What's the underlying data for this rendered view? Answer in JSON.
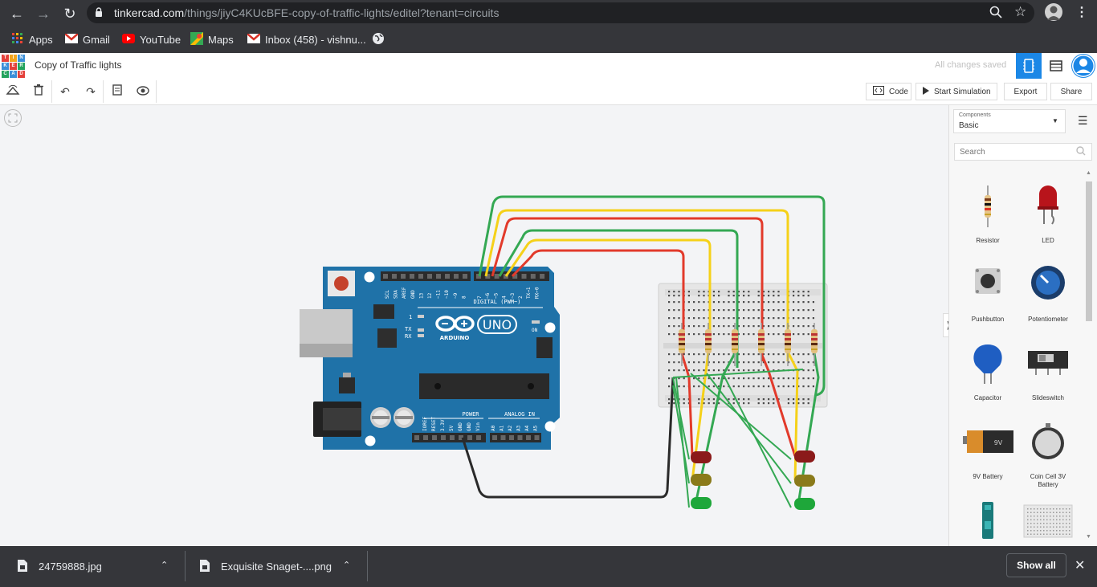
{
  "browser": {
    "url_host": "tinkercad.com",
    "url_path": "/things/jiyC4KUcBFE-copy-of-traffic-lights/editel?tenant=circuits",
    "bookmarks": [
      {
        "label": "Apps",
        "icon": "apps-grid-icon",
        "color": "#e8eaed"
      },
      {
        "label": "Gmail",
        "icon": "gmail-icon",
        "color": "#d93025"
      },
      {
        "label": "YouTube",
        "icon": "youtube-icon",
        "color": "#ff0000"
      },
      {
        "label": "Maps",
        "icon": "maps-icon",
        "color": "#34a853"
      },
      {
        "label": "Inbox (458) - vishnu...",
        "icon": "gmail-icon",
        "color": "#d93025"
      }
    ]
  },
  "header": {
    "logo_letters": [
      "TIN",
      "KER",
      "CAD"
    ],
    "title": "Copy of Traffic lights",
    "save_status": "All changes saved",
    "accent": "#1b87e6"
  },
  "toolbar": {
    "code_label": "Code",
    "start_label": "Start Simulation",
    "export_label": "Export",
    "share_label": "Share"
  },
  "board": {
    "name": "UNO",
    "brand": "ARDUINO",
    "digital_label": "DIGITAL (PWM~)",
    "power_label": "POWER",
    "analog_label": "ANALOG IN",
    "pin_labels": [
      "SCL",
      "SDA",
      "AREF",
      "GND",
      "13",
      "12",
      "~11",
      "~10",
      "~9",
      "8",
      "7",
      "~6",
      "~5",
      "4",
      "~3",
      "2",
      "TX→1",
      "RX←0"
    ],
    "power_pins": [
      "IOREF",
      "RESET",
      "3.3V",
      "5V",
      "GND",
      "GND",
      "Vin"
    ],
    "analog_pins": [
      "A0",
      "A1",
      "A2",
      "A3",
      "A4",
      "A5"
    ],
    "tx_label": "TX",
    "rx_label": "RX",
    "on_label": "ON",
    "l_label": "L",
    "one_label": "1"
  },
  "panel": {
    "select_caption": "Components",
    "select_value": "Basic",
    "search_placeholder": "Search",
    "components": [
      {
        "label": "Resistor"
      },
      {
        "label": "LED"
      },
      {
        "label": "Pushbutton"
      },
      {
        "label": "Potentiometer"
      },
      {
        "label": "Capacitor"
      },
      {
        "label": "Slideswitch"
      },
      {
        "label": "9V Battery",
        "text": "9V"
      },
      {
        "label": "Coin Cell 3V Battery"
      }
    ]
  },
  "downloads": {
    "items": [
      {
        "name": "24759888.jpg"
      },
      {
        "name": "Exquisite Snaget-....png"
      }
    ],
    "show_all": "Show all"
  }
}
